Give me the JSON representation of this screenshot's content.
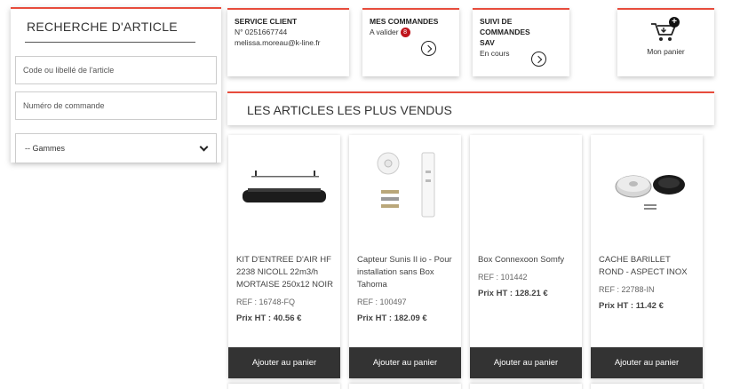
{
  "search": {
    "title": "RECHERCHE D'ARTICLE",
    "article_placeholder": "Code ou libellé de l'article",
    "order_placeholder": "Numéro de commande",
    "range_selected": "-- Gammes"
  },
  "cards": {
    "service": {
      "title": "SERVICE CLIENT",
      "phone": "N° 0251667744",
      "email": "melissa.moreau@k-line.fr"
    },
    "orders": {
      "title": "MES COMMANDES",
      "status": "A valider",
      "badge": "8"
    },
    "sav": {
      "title_line1": "SUIVI DE COMMANDES",
      "title_line2": "SAV",
      "status": "En cours"
    },
    "cart": {
      "label": "Mon panier",
      "badge": "+"
    }
  },
  "section": {
    "title": "LES ARTICLES LES PLUS VENDUS"
  },
  "products": [
    {
      "name": "KIT D'ENTREE D'AIR HF 2238 NICOLL 22m3/h MORTAISE 250x12 NOIR",
      "ref": "REF : 16748-FQ",
      "price_label": "Prix HT : ",
      "price": "40.56 €",
      "button": "Ajouter au panier"
    },
    {
      "name": "Capteur Sunis II io - Pour installation sans Box Tahoma",
      "ref": "REF : 100497",
      "price_label": "Prix HT : ",
      "price": "182.09 €",
      "button": "Ajouter au panier"
    },
    {
      "name": "Box Connexoon Somfy",
      "ref": "REF : 101442",
      "price_label": "Prix HT : ",
      "price": "128.21 €",
      "button": "Ajouter au panier"
    },
    {
      "name": "CACHE BARILLET ROND - ASPECT INOX",
      "ref": "REF : 22788-IN",
      "price_label": "Prix HT : ",
      "price": "11.42 €",
      "button": "Ajouter au panier"
    }
  ],
  "colors": {
    "accent": "#e74c3c",
    "badge": "#c0141c",
    "button": "#333333"
  }
}
